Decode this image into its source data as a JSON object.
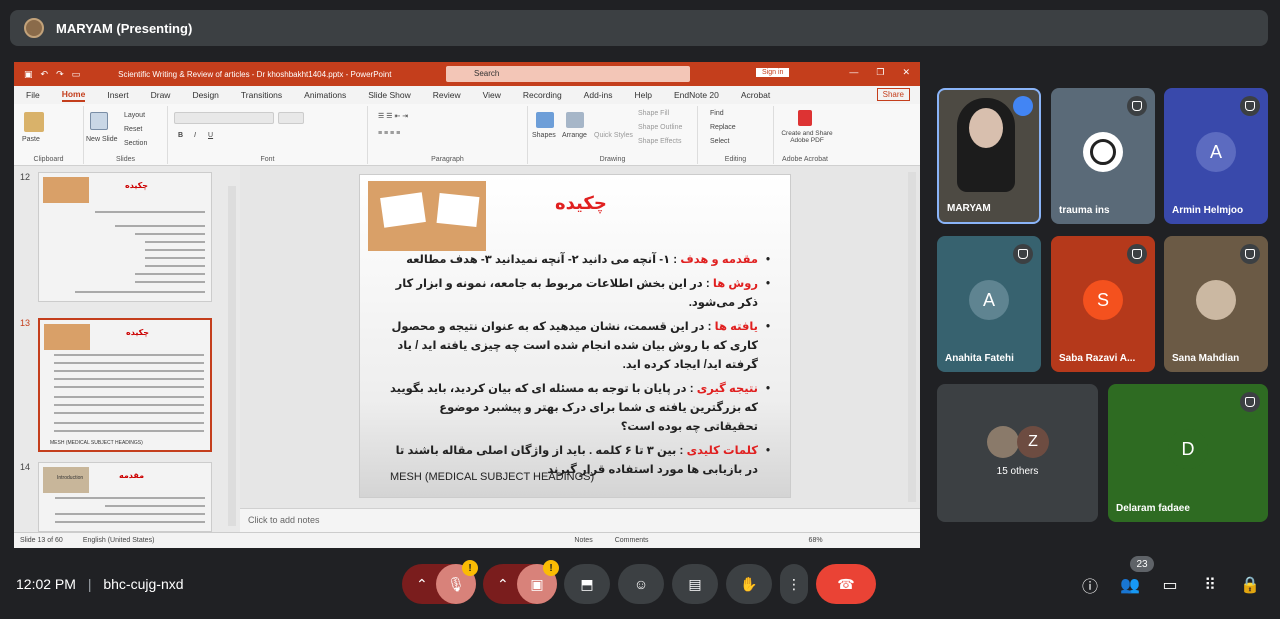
{
  "meeting": {
    "presenter_label": "MARYAM (Presenting)",
    "time": "12:02 PM",
    "divider": "|",
    "code": "bhc-cujg-nxd",
    "participant_count": "23"
  },
  "ppt": {
    "doc_title": "Scientific Writing & Review of articles - Dr khoshbakht1404.pptx  -  PowerPoint",
    "search_placeholder": "Search",
    "signin": "Sign in",
    "tabs": [
      "File",
      "Home",
      "Insert",
      "Draw",
      "Design",
      "Transitions",
      "Animations",
      "Slide Show",
      "Review",
      "View",
      "Recording",
      "Add-ins",
      "Help",
      "EndNote 20",
      "Acrobat"
    ],
    "share": "Share",
    "ribbon": {
      "paste": "Paste",
      "new_slide": "New Slide",
      "layout": "Layout",
      "reset": "Reset",
      "section": "Section",
      "groups": [
        "Clipboard",
        "Slides",
        "Font",
        "Paragraph",
        "Drawing",
        "Editing",
        "Adobe Acrobat"
      ],
      "shapes": "Shapes",
      "arrange": "Arrange",
      "quick_styles": "Quick Styles",
      "shape_fill": "Shape Fill",
      "shape_outline": "Shape Outline",
      "shape_effects": "Shape Effects",
      "find": "Find",
      "replace": "Replace",
      "select": "Select",
      "acrobat": "Create and Share Adobe PDF"
    },
    "thumbs": [
      {
        "num": "12",
        "title": "چکیده"
      },
      {
        "num": "13",
        "title": "چکیده"
      },
      {
        "num": "14",
        "title": "مقدمه",
        "img_label": "Introduction"
      }
    ],
    "slide": {
      "title": "چکیده",
      "bullets": [
        {
          "kw": "مقدمه و هدف",
          "text": " :  ۱- آنچه می دانید ۲- آنچه نمیدانید ۳- هدف مطالعه"
        },
        {
          "kw": "روش ها",
          "text": " : در این بخش اطلاعات مربوط به جامعه، نمونه و ابزار کار ذکر می‌شود."
        },
        {
          "kw": "یافته ها",
          "text": " : در این قسمت، نشان میدهید که به عنوان نتیجه و محصول کاری که با روش بیان شده انجام شده است چه چیزی یافته اید / یاد گرفته اید/ ایجاد کرده اید."
        },
        {
          "kw": "نتیجه گیری",
          "text": " : در پایان با توجه به مسئله ای که بیان کردید، باید بگویید که بزرگترین یافته ی شما برای درک بهتر و پیشبرد موضوع تحقیقاتی چه بوده است؟"
        },
        {
          "kw": "کلمات کلیدی",
          "text": " : بین ۳ تا ۶ کلمه  . باید از واژگان اصلی مقاله باشند تا در بازیابی ها مورد استفاده قرار گیرند"
        }
      ],
      "mesh": "MESH (MEDICAL SUBJECT HEADINGS)"
    },
    "notes_placeholder": "Click to add notes",
    "status": {
      "slide_of": "Slide 13 of 60",
      "language": "English (United States)",
      "notes": "Notes",
      "comments": "Comments",
      "zoom": "68%"
    }
  },
  "participants": [
    {
      "name": "MARYAM",
      "color": "#3a3a3a"
    },
    {
      "name": "trauma ins",
      "color": "#5a6a78"
    },
    {
      "name": "Armin Helmjoo",
      "initial": "A",
      "color": "#3949ab"
    },
    {
      "name": "Anahita Fatehi",
      "initial": "A",
      "color": "#37626f"
    },
    {
      "name": "Saba Razavi A...",
      "initial": "S",
      "color": "#b5391b"
    },
    {
      "name": "Sana Mahdian",
      "color": "#6b5a45"
    },
    {
      "name": "15 others",
      "initial": "Z"
    },
    {
      "name": "Delaram fadaee",
      "initial": "D",
      "color": "#2e6b22"
    }
  ],
  "colors": {
    "end_call": "#ea4335",
    "warn_btn": "#d8827a",
    "ppt_accent": "#c43e1c"
  }
}
